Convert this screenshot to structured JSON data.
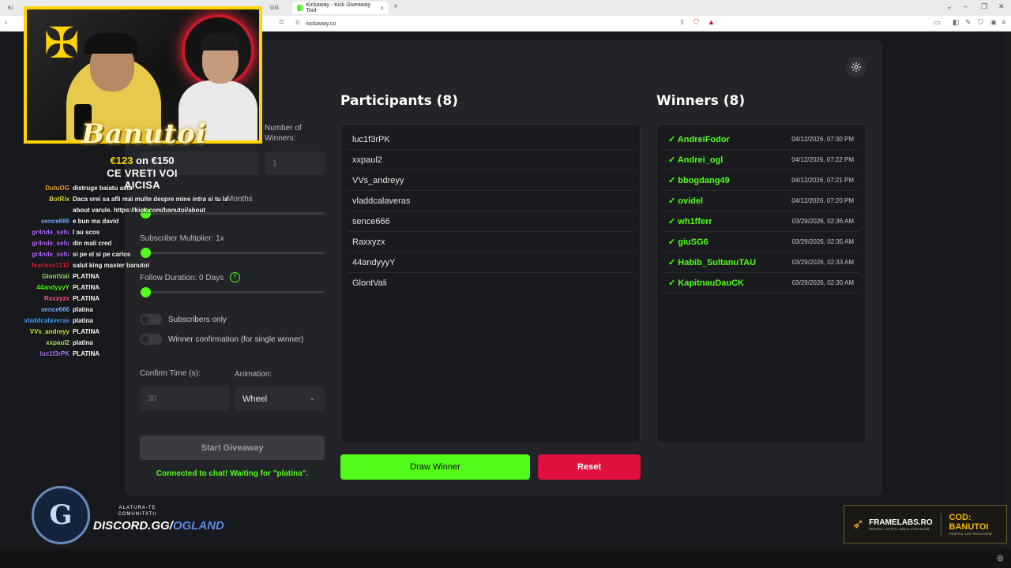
{
  "browser": {
    "tabs": [
      {
        "label": "Ki",
        "active": false
      },
      {
        "label": "GG",
        "active": false
      },
      {
        "label": "Kickaway - Kick Giveaway Tool",
        "active": true
      }
    ],
    "new_tab": "+",
    "url": "kickaway.co",
    "controls": {
      "minimize": "–",
      "restore": "❐",
      "close": "✕"
    }
  },
  "app": {
    "left": {
      "number_of_winners_label": "Number of Winners:",
      "number_of_winners_value": "1",
      "months_label": "Months",
      "subscriber_multiplier_label": "Subscriber Multiplier: 1x",
      "follow_duration_label": "Follow Duration:  0  Days",
      "subscribers_only_label": "Subscribers only",
      "winner_confirmation_label": "Winner confirmation (for single winner)",
      "confirm_time_label": "Confirm Time (s):",
      "confirm_time_placeholder": "30",
      "animation_label": "Animation:",
      "animation_value": "Wheel",
      "start_button": "Start Giveaway",
      "status": "Connected to chat! Waiting for \"platina\"."
    },
    "participants": {
      "title": "Participants (8)",
      "items": [
        "luc1f3rPK",
        "xxpaul2",
        "VVs_andreyy",
        "vladdcalaveras",
        "sence666",
        "Raxxyzx",
        "44andyyyY",
        "GlontVali"
      ]
    },
    "winners": {
      "title": "Winners (8)",
      "items": [
        {
          "name": "✓ AndreiFodor",
          "date": "04/12/2026, 07:30 PM"
        },
        {
          "name": "✓ Andrei_ogl",
          "date": "04/12/2026, 07:22 PM"
        },
        {
          "name": "✓ bbogdang49",
          "date": "04/12/2026, 07:21 PM"
        },
        {
          "name": "✓ ovidel",
          "date": "04/12/2026, 07:20 PM"
        },
        {
          "name": "✓ wh1fferr",
          "date": "03/29/2026, 02:36 AM"
        },
        {
          "name": "✓ giuSG6",
          "date": "03/29/2026, 02:35 AM"
        },
        {
          "name": "✓ Habib_SultanuTAU",
          "date": "03/29/2026, 02:33 AM"
        },
        {
          "name": "✓ KapitnauDauCK",
          "date": "03/29/2026, 02:30 AM"
        }
      ]
    },
    "draw_button": "Draw Winner",
    "reset_button": "Reset",
    "colors": {
      "accent": "#53fc18",
      "reset": "#e0113f",
      "panel": "#222428"
    }
  },
  "overlay": {
    "streamer_name": "Banutoi",
    "goal_current": "€123",
    "goal_on": "on",
    "goal_target": "€150",
    "tagline": "CE VRETI VOI AICISA",
    "chat": [
      {
        "user": "DutuOG",
        "color": "#f2a33a",
        "msg": "distruge baiatu asta"
      },
      {
        "user": "BotRix",
        "color": "#e9d84a",
        "msg": "Daca vrei sa afli mai multe despre mine intra si tu la about varule. https://kick.com/banutoi/about"
      },
      {
        "user": "sence666",
        "color": "#7fb0ff",
        "msg": "e bun ma david"
      },
      {
        "user": "gr4nde_sefu",
        "color": "#b66dff",
        "msg": "l au scos"
      },
      {
        "user": "gr4nde_sefu",
        "color": "#b66dff",
        "msg": "din mali cred"
      },
      {
        "user": "gr4nde_sefu",
        "color": "#b66dff",
        "msg": "si pe el si pe carlos"
      },
      {
        "user": "fearless1312",
        "color": "#e0263a",
        "msg": "salut king master banutoi"
      },
      {
        "user": "GlontVali",
        "color": "#9be36a",
        "msg": "PLATINA"
      },
      {
        "user": "44andyyyY",
        "color": "#53fc18",
        "msg": "PLATINA"
      },
      {
        "user": "Raxxyzx",
        "color": "#ff5c8a",
        "msg": "PLATINA"
      },
      {
        "user": "sence666",
        "color": "#7fb0ff",
        "msg": "platina"
      },
      {
        "user": "vladdcalaveras",
        "color": "#4aa3ff",
        "msg": "platina"
      },
      {
        "user": "VVs_andreyy",
        "color": "#c6f03c",
        "msg": "PLATINA"
      },
      {
        "user": "xxpaul2",
        "color": "#a8e86b",
        "msg": "platina"
      },
      {
        "user": "luc1f3rPK",
        "color": "#b07cff",
        "msg": "PLATINA"
      }
    ],
    "discord_small": "ALATURA-TE COMUNITATII",
    "discord_main_prefix": "DISCORD.GG/",
    "discord_main_highlight": "OGLAND",
    "discord_logo_letter": "G",
    "framelabs_name": "FRAMELABS.RO",
    "framelabs_sub": "PENTRU CĂ FPS-URILE CONTEAZĂ",
    "framelabs_code": "COD: BANUTOI",
    "framelabs_discount": "PENTRU 10% REDUCERE"
  }
}
